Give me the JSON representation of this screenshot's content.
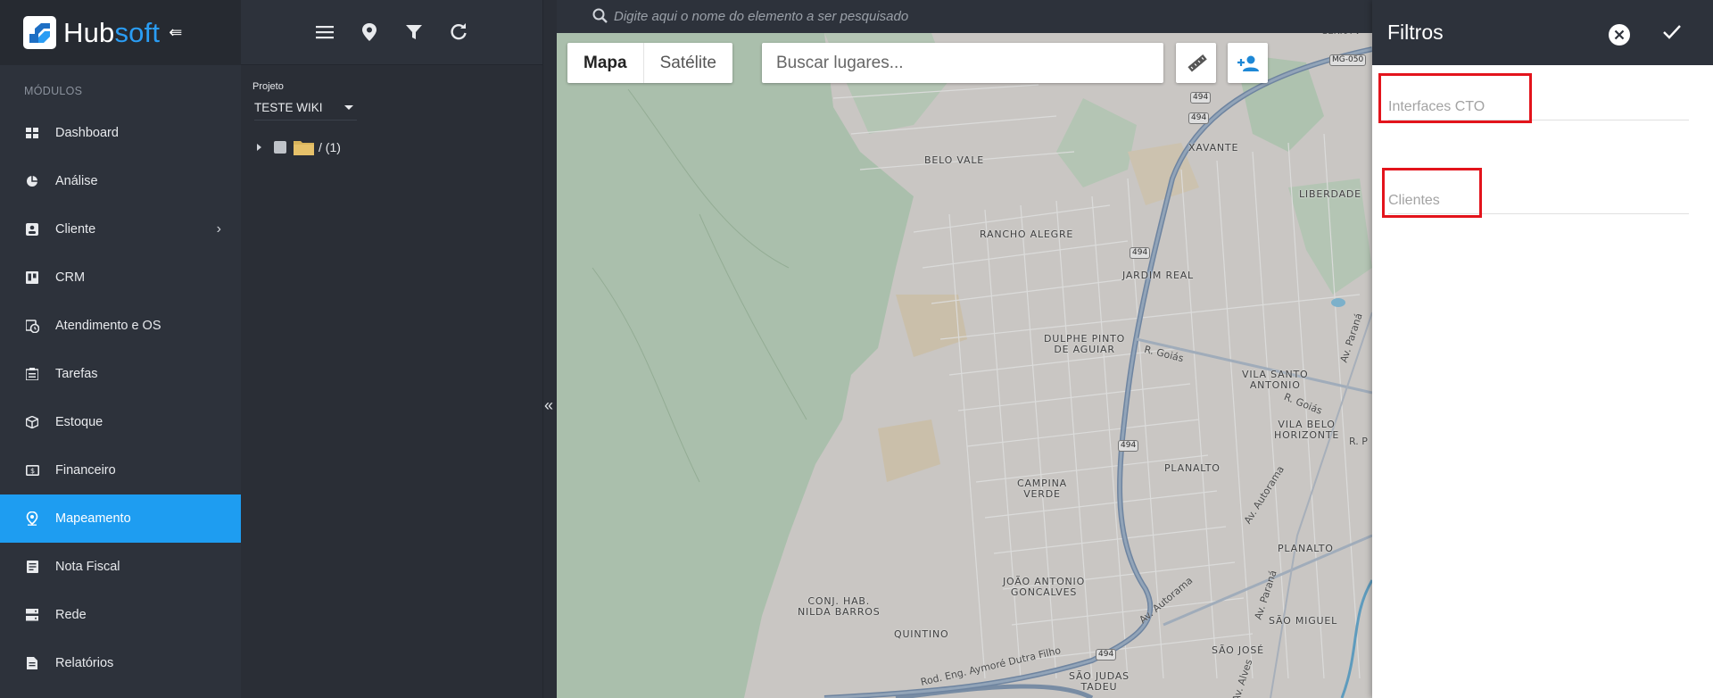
{
  "app": {
    "brand_hub": "Hub",
    "brand_soft": "soft",
    "brand_color": "#2a9df4",
    "accent_color": "#1e9df1"
  },
  "sidebar": {
    "section_title": "MÓDULOS",
    "items": [
      {
        "label": "Dashboard",
        "icon": "dashboard-icon"
      },
      {
        "label": "Análise",
        "icon": "pie-chart-icon"
      },
      {
        "label": "Cliente",
        "icon": "contact-card-icon",
        "has_submenu": true
      },
      {
        "label": "CRM",
        "icon": "kanban-icon"
      },
      {
        "label": "Atendimento e OS",
        "icon": "clock-calendar-icon"
      },
      {
        "label": "Tarefas",
        "icon": "tasks-icon"
      },
      {
        "label": "Estoque",
        "icon": "box-icon"
      },
      {
        "label": "Financeiro",
        "icon": "money-icon"
      },
      {
        "label": "Mapeamento",
        "icon": "map-pin-icon",
        "active": true
      },
      {
        "label": "Nota Fiscal",
        "icon": "invoice-icon"
      },
      {
        "label": "Rede",
        "icon": "server-icon"
      },
      {
        "label": "Relatórios",
        "icon": "report-icon"
      }
    ]
  },
  "project_panel": {
    "toolbar_icons": [
      "menu-icon",
      "map-marker-icon",
      "filter-icon",
      "refresh-icon"
    ],
    "project_label": "Projeto",
    "project_value": "TESTE WIKI",
    "tree_root_label": "/ (1)"
  },
  "map": {
    "search_placeholder": "Digite aqui o nome do elemento a ser pesquisado",
    "map_type_map": "Mapa",
    "map_type_satellite": "Satélite",
    "places_placeholder": "Buscar lugares...",
    "neighborhoods": [
      "BELO VALE",
      "XAVANTE",
      "LIBERDADE",
      "RANCHO ALEGRE",
      "JARDIM REAL",
      "DULPHE PINTO\nDE AGUIAR",
      "VILA SANTO\nANTONIO",
      "VILA BELO\nHORIZONTE",
      "PLANALTO",
      "CAMPINA\nVERDE",
      "PLANALTO",
      "JOÃO ANTONIO\nGONCALVES",
      "CONJ. HAB.\nNILDA BARROS",
      "QUINTINO",
      "SÃO MIGUEL",
      "SÃO JOSÉ",
      "SÃO JUDAS\nTADEU"
    ],
    "streets": [
      "R. Goiás",
      "R. Goiás",
      "Av. Paraná",
      "R. P",
      "Av. Autorama",
      "Av. Autorama",
      "Av. Paraná",
      "Rod. Eng. Aymoré Dutra Filho",
      "Av. Alves"
    ],
    "road_shields": [
      "494",
      "494",
      "494",
      "494",
      "494",
      "MG-050"
    ],
    "top_cut_label": "SERRA V"
  },
  "filters": {
    "title": "Filtros",
    "fields": [
      {
        "placeholder": "Interfaces CTO",
        "value": ""
      },
      {
        "placeholder": "Clientes",
        "value": ""
      }
    ],
    "highlight_color": "#e3141c"
  }
}
